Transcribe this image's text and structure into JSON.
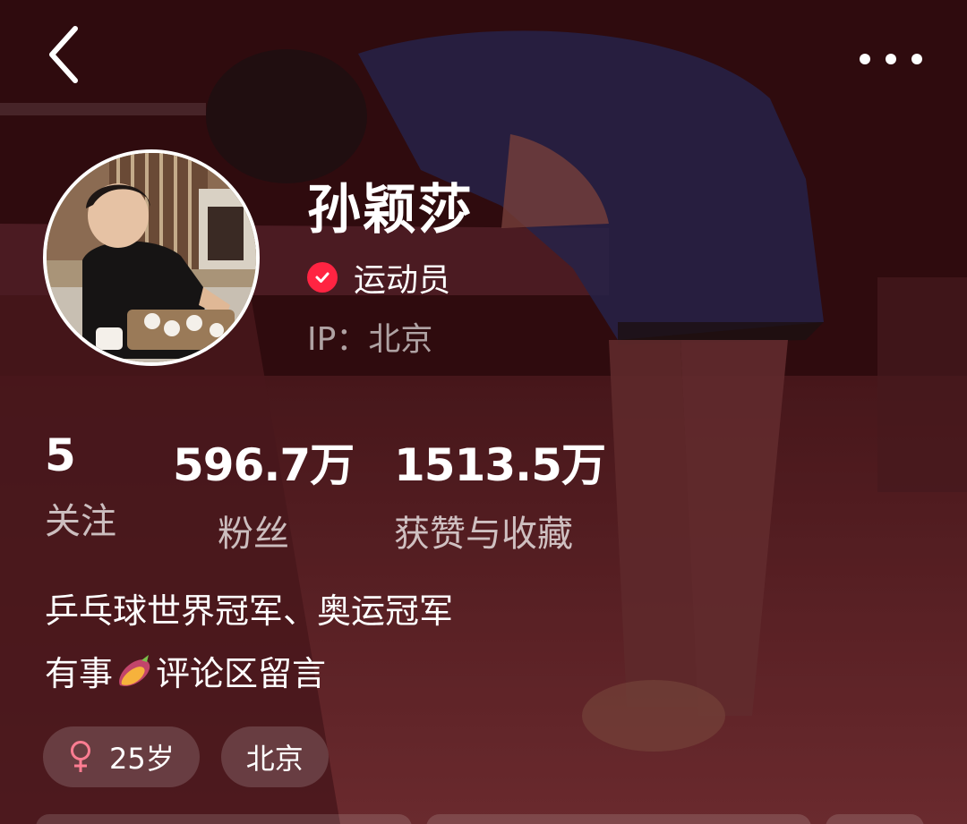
{
  "header": {
    "back_icon": "back-chevron-icon",
    "more_icon": "more-horizontal-icon"
  },
  "profile": {
    "name": "孙颖莎",
    "verified_label": "运动员",
    "ip": "IP：北京"
  },
  "stats": [
    {
      "value": "5",
      "label": "关注"
    },
    {
      "value": "596.7万",
      "label": "粉丝"
    },
    {
      "value": "1513.5万",
      "label": "获赞与收藏"
    }
  ],
  "bio": {
    "line1": "乒乓球世界冠军、奥运冠军",
    "line2_prefix": "有事",
    "line2_suffix": "评论区留言"
  },
  "tags": {
    "age": "25岁",
    "location": "北京"
  },
  "colors": {
    "accent": "#ff2442",
    "female": "#ff7d92"
  }
}
